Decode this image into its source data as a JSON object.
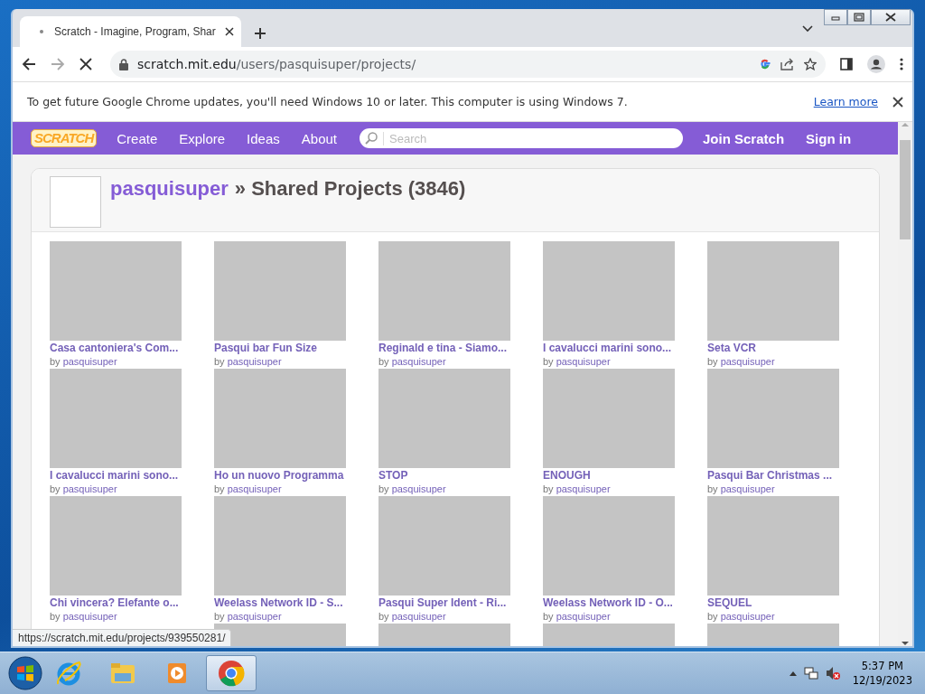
{
  "browser": {
    "tab_title": "Scratch - Imagine, Program, Shar",
    "address_host": "scratch.mit.edu",
    "address_path": "/users/pasquisuper/projects/",
    "loading": true
  },
  "infobar": {
    "message": "To get future Google Chrome updates, you'll need Windows 10 or later. This computer is using Windows 7.",
    "link": "Learn more"
  },
  "nav": {
    "logo": "SCRATCH",
    "items": [
      "Create",
      "Explore",
      "Ideas",
      "About"
    ],
    "search_placeholder": "Search",
    "join": "Join Scratch",
    "sign_in": "Sign in"
  },
  "header": {
    "user": "pasquisuper",
    "title": "» Shared Projects (3846)"
  },
  "projects": [
    {
      "title": "Casa cantoniera's Com...",
      "by": "by",
      "author": "pasquisuper"
    },
    {
      "title": "Pasqui bar Fun Size",
      "by": "by",
      "author": "pasquisuper"
    },
    {
      "title": "Reginald e tina - Siamo...",
      "by": "by",
      "author": "pasquisuper"
    },
    {
      "title": "I cavalucci marini sono...",
      "by": "by",
      "author": "pasquisuper"
    },
    {
      "title": "Seta VCR",
      "by": "by",
      "author": "pasquisuper"
    },
    {
      "title": "I cavalucci marini sono...",
      "by": "by",
      "author": "pasquisuper"
    },
    {
      "title": "Ho un nuovo Programma",
      "by": "by",
      "author": "pasquisuper"
    },
    {
      "title": "STOP",
      "by": "by",
      "author": "pasquisuper"
    },
    {
      "title": "ENOUGH",
      "by": "by",
      "author": "pasquisuper"
    },
    {
      "title": "Pasqui Bar Christmas ...",
      "by": "by",
      "author": "pasquisuper"
    },
    {
      "title": "Chi vincera? Elefante o...",
      "by": "by",
      "author": "pasquisuper"
    },
    {
      "title": "Weelass Network ID - S...",
      "by": "by",
      "author": "pasquisuper"
    },
    {
      "title": "Pasqui Super Ident - Ri...",
      "by": "by",
      "author": "pasquisuper"
    },
    {
      "title": "Weelass Network ID - O...",
      "by": "by",
      "author": "pasquisuper"
    },
    {
      "title": "SEQUEL",
      "by": "by",
      "author": "pasquisuper"
    }
  ],
  "next_row": [
    {
      "kind": "covered"
    },
    {
      "kind": "thumbnail"
    },
    {
      "kind": "thumbnail"
    },
    {
      "kind": "thumbnail"
    },
    {
      "kind": "thumbnail"
    }
  ],
  "status_bubble": "https://scratch.mit.edu/projects/939550281/",
  "taskbar": {
    "apps": [
      {
        "kind": "ie",
        "selected": false
      },
      {
        "kind": "folder",
        "selected": false
      },
      {
        "kind": "media",
        "selected": false
      },
      {
        "kind": "chrome",
        "selected": true
      }
    ],
    "time": "5:37 PM",
    "date": "12/19/2023"
  }
}
